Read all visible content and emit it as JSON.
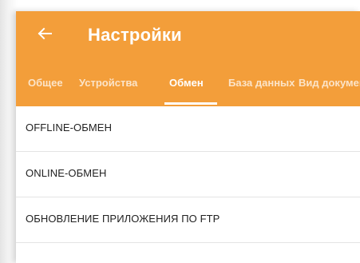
{
  "header": {
    "title": "Настройки",
    "back_icon": "arrow-left-icon",
    "background_color": "#f39e3a"
  },
  "tabs": [
    {
      "label": "Общее"
    },
    {
      "label": "Устройства"
    },
    {
      "label": "Обмен",
      "active": true
    },
    {
      "label": "База данных"
    },
    {
      "label": "Вид документа"
    }
  ],
  "settings": [
    {
      "label": "OFFLINE-ОБМЕН"
    },
    {
      "label": "ONLINE-ОБМЕН"
    },
    {
      "label": "ОБНОВЛЕНИЕ ПРИЛОЖЕНИЯ ПО FTP"
    }
  ]
}
